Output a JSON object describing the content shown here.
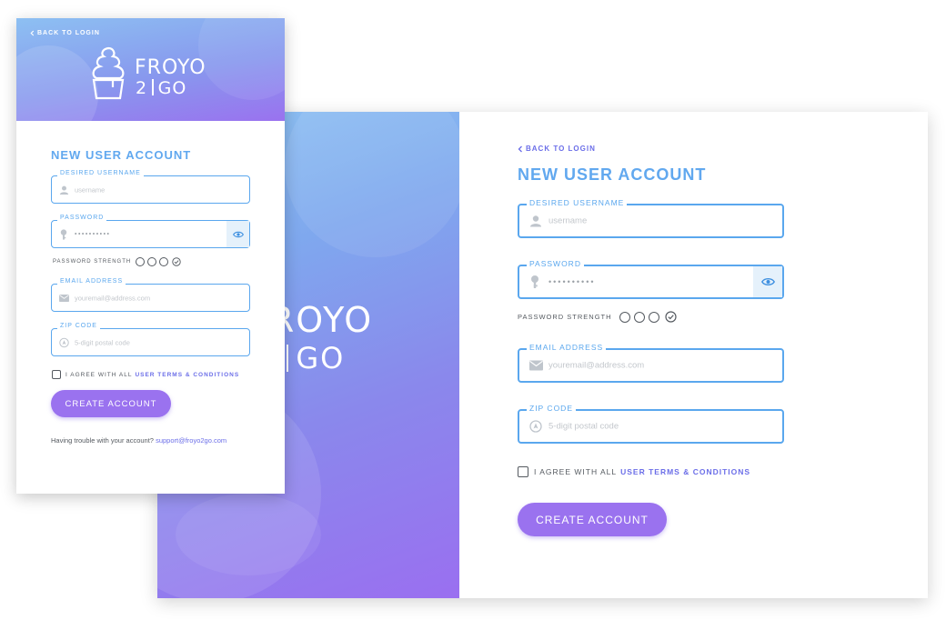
{
  "brand": {
    "name": "FROYO",
    "sub_left": "2",
    "sub_right": "GO"
  },
  "back_link": "BACK TO LOGIN",
  "form_title": "NEW USER ACCOUNT",
  "fields": {
    "username": {
      "label": "DESIRED USERNAME",
      "placeholder": "username",
      "icon": "user-icon"
    },
    "password": {
      "label": "PASSWORD",
      "value": "••••••••••",
      "icon": "key-icon",
      "toggle_icon": "eye-icon"
    },
    "email": {
      "label": "EMAIL ADDRESS",
      "placeholder": "youremail@address.com",
      "icon": "envelope-icon"
    },
    "zip": {
      "label": "ZIP CODE",
      "placeholder": "5-digit postal code",
      "icon": "location-icon"
    }
  },
  "password_strength": {
    "label": "PASSWORD STRENGTH",
    "levels": 3,
    "filled": 0
  },
  "agree": {
    "prefix": "I AGREE WITH ALL",
    "link": "USER TERMS & CONDITIONS"
  },
  "submit_label": "CREATE ACCOUNT",
  "help": {
    "text": "Having trouble with your account?",
    "email": "support@froyo2go.com"
  },
  "colors": {
    "accent_blue": "#5aa7ee",
    "accent_purple": "#9a72ef",
    "link": "#6b6ee8"
  }
}
